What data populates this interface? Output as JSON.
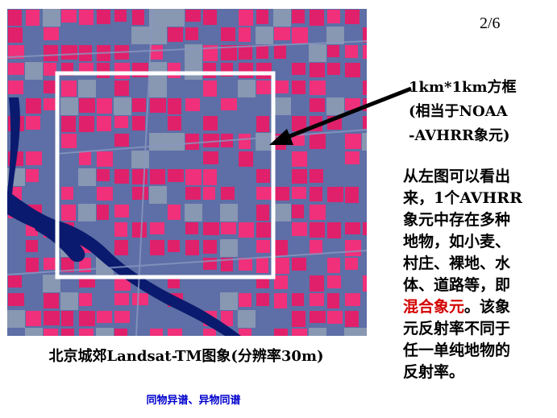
{
  "page_number": "2/6",
  "image": {
    "description_name": "Beijing suburb Landsat-TM false color image",
    "colors": {
      "base": "#5e6ea6",
      "field": "#e0206a",
      "field_alt": "#f0307a",
      "water": "#0a1a6e",
      "bare": "#9aa8b8",
      "frame": "#ffffff",
      "arrow": "#000000"
    }
  },
  "callout": {
    "lines": [
      "1km*1km方框",
      "(相当于NOAA",
      "-AVHRR象元)"
    ]
  },
  "description": {
    "lines": [
      "从左图可以看出",
      "来，1个AVHRR",
      "象元中存在多种",
      "地物，如小麦、",
      "村庄、裸地、水",
      "体、道路等，即"
    ],
    "highlight_line": {
      "highlight": "混合象元",
      "rest": "。该象"
    },
    "lines_after": [
      "元反射率不同于",
      "任一单纯地物的",
      "反射率。"
    ]
  },
  "caption": "北京城郊Landsat-TM图象(分辨率30m)",
  "subcaption": "同物异谱、异物同谱"
}
